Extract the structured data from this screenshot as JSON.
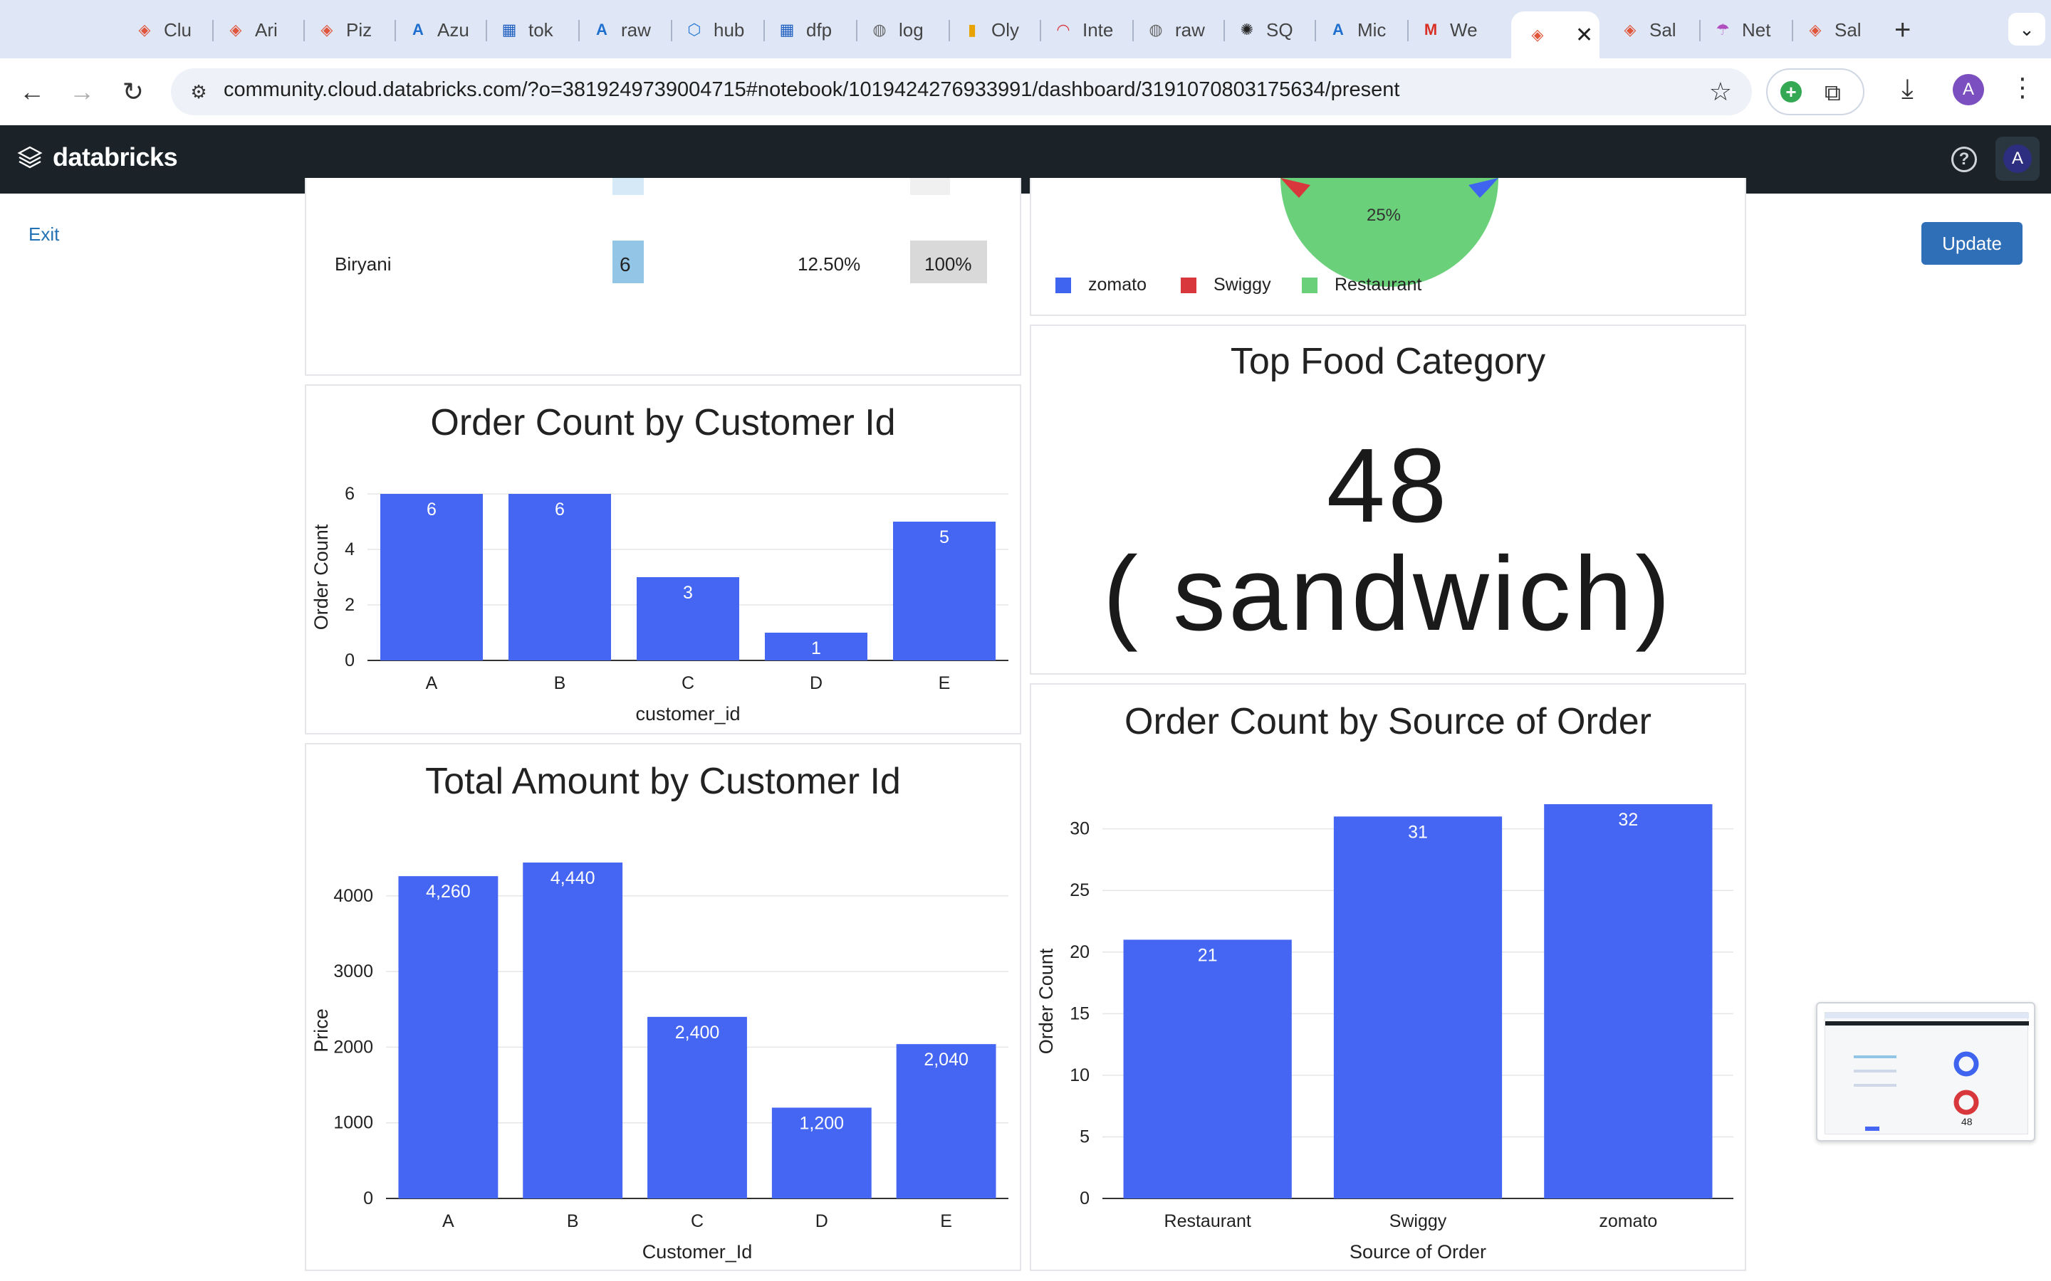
{
  "browser": {
    "tabs": [
      {
        "title": "Clu",
        "icon": "databricks-icon"
      },
      {
        "title": "Ari",
        "icon": "databricks-icon"
      },
      {
        "title": "Piz",
        "icon": "databricks-icon"
      },
      {
        "title": "Azu",
        "icon": "azure-icon"
      },
      {
        "title": "tok",
        "icon": "factory-icon"
      },
      {
        "title": "raw",
        "icon": "azure-icon"
      },
      {
        "title": "hub",
        "icon": "hub-icon"
      },
      {
        "title": "dfp",
        "icon": "factory-icon"
      },
      {
        "title": "log",
        "icon": "globe-icon"
      },
      {
        "title": "Oly",
        "icon": "chart-icon"
      },
      {
        "title": "Inte",
        "icon": "gauge-icon"
      },
      {
        "title": "raw",
        "icon": "globe-icon"
      },
      {
        "title": "SQ",
        "icon": "openai-icon"
      },
      {
        "title": "Mic",
        "icon": "azure-icon"
      },
      {
        "title": "We",
        "icon": "gmail-icon"
      },
      {
        "title": "",
        "icon": "databricks-icon",
        "active": true
      },
      {
        "title": "Sal",
        "icon": "databricks-icon"
      },
      {
        "title": "Net",
        "icon": "umbrella-icon"
      },
      {
        "title": "Sal",
        "icon": "databricks-icon"
      }
    ],
    "url": "community.cloud.databricks.com/?o=3819249739004715#notebook/1019424276933991/dashboard/3191070803175634/present",
    "profile_initial": "A"
  },
  "app": {
    "brand": "databricks",
    "user_initial": "A",
    "exit_label": "Exit",
    "update_label": "Update"
  },
  "table": {
    "row": {
      "food": "Biryani",
      "count": "6",
      "percent": "12.50%",
      "share": "100%"
    }
  },
  "pie_legend": [
    {
      "label": "zomato",
      "color": "#3e64f0"
    },
    {
      "label": "Swiggy",
      "color": "#d8383b"
    },
    {
      "label": "Restaurant",
      "color": "#6bd07a"
    }
  ],
  "pie_visible_label": "25%",
  "counter": {
    "title": "Top Food Category",
    "value": "48",
    "label": "( sandwich)"
  },
  "colors": {
    "bar": "#4466f2",
    "header": "#1b2328",
    "accent": "#2e6fb7"
  },
  "chart_data": [
    {
      "type": "bar",
      "title": "Order Count by Customer Id",
      "xlabel": "customer_id",
      "ylabel": "Order Count",
      "categories": [
        "A",
        "B",
        "C",
        "D",
        "E"
      ],
      "values": [
        6,
        6,
        3,
        1,
        5
      ],
      "labels": [
        "6",
        "6",
        "3",
        "1",
        "5"
      ],
      "yticks": [
        0,
        2,
        4,
        6
      ],
      "ylim": [
        0,
        6
      ]
    },
    {
      "type": "bar",
      "title": "Total Amount by Customer Id",
      "xlabel": "Customer_Id",
      "ylabel": "Price",
      "categories": [
        "A",
        "B",
        "C",
        "D",
        "E"
      ],
      "values": [
        4260,
        4440,
        2400,
        1200,
        2040
      ],
      "labels": [
        "4,260",
        "4,440",
        "2,400",
        "1,200",
        "2,040"
      ],
      "yticks": [
        0,
        1000,
        2000,
        3000,
        4000
      ],
      "ylim": [
        0,
        4440
      ]
    },
    {
      "type": "bar",
      "title": "Order Count by Source of Order",
      "xlabel": "Source of Order",
      "ylabel": "Order Count",
      "categories": [
        "Restaurant",
        "Swiggy",
        "zomato"
      ],
      "values": [
        21,
        31,
        32
      ],
      "labels": [
        "21",
        "31",
        "32"
      ],
      "yticks": [
        0,
        5,
        10,
        15,
        20,
        25,
        30
      ],
      "ylim": [
        0,
        32
      ]
    }
  ],
  "thumbnail": {
    "value": "48"
  }
}
